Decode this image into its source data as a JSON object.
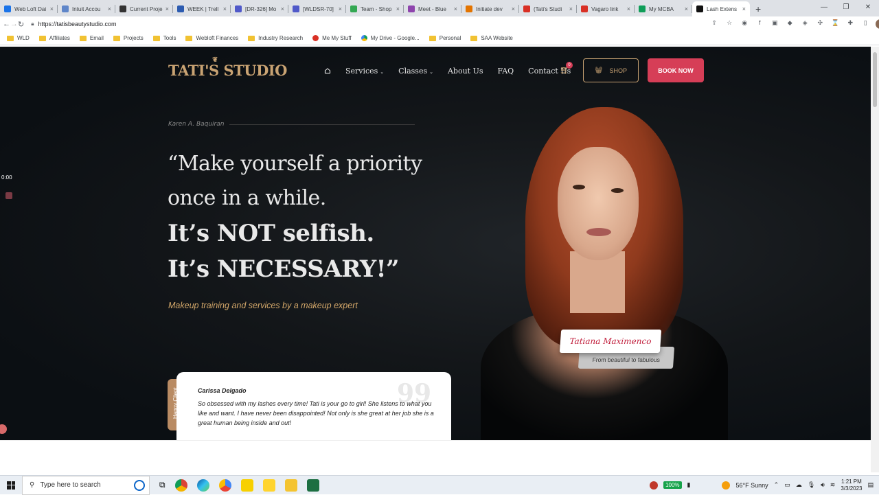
{
  "browser": {
    "tabs": [
      {
        "title": "Web Loft Dai",
        "color": "#1a73e8"
      },
      {
        "title": "Intuit Accou",
        "color": "#5f86c9"
      },
      {
        "title": "Current Proje",
        "color": "#333333"
      },
      {
        "title": "WEEK | Trell",
        "color": "#2c5bb0"
      },
      {
        "title": "[DR-326] Mo",
        "color": "#5059c9"
      },
      {
        "title": "[WLDSR-70]",
        "color": "#5059c9"
      },
      {
        "title": "Team - Shop",
        "color": "#34a853"
      },
      {
        "title": "Meet - Blue",
        "color": "#8e44ad"
      },
      {
        "title": "Initiate dev",
        "color": "#e37400"
      },
      {
        "title": "(Tati's Studi",
        "color": "#d93025"
      },
      {
        "title": "Vagaro link",
        "color": "#d93025"
      },
      {
        "title": "My MCBA",
        "color": "#0f9d58"
      },
      {
        "title": "Lash Extens",
        "color": "#111111"
      }
    ],
    "url": "https://tatisbeautystudio.com",
    "bookmarks": [
      {
        "label": "WLD",
        "kind": "folder"
      },
      {
        "label": "Affiliates",
        "kind": "folder"
      },
      {
        "label": "Email",
        "kind": "folder"
      },
      {
        "label": "Projects",
        "kind": "folder"
      },
      {
        "label": "Tools",
        "kind": "folder"
      },
      {
        "label": "Webloft Finances",
        "kind": "folder"
      },
      {
        "label": "Industry Research",
        "kind": "folder"
      },
      {
        "label": "Me My Stuff",
        "kind": "dot"
      },
      {
        "label": "My Drive - Google...",
        "kind": "drive"
      },
      {
        "label": "Personal",
        "kind": "folder"
      },
      {
        "label": "SAA Website",
        "kind": "folder"
      }
    ]
  },
  "site": {
    "logo": "TATI'S STUDIO",
    "nav": {
      "services": "Services",
      "classes": "Classes",
      "about": "About Us",
      "faq": "FAQ",
      "contact": "Contact Us"
    },
    "cart_count": "0",
    "shop_label": "SHOP",
    "book_label": "BOOK NOW",
    "author": "Karen A. Baquiran",
    "quote_line1": "“Make yourself a priority",
    "quote_line2": "once in a while.",
    "quote_line3": "It’s NOT selfish.",
    "quote_line4": "It’s NECESSARY!”",
    "tagline": "Makeup training and services by a makeup expert",
    "signature": "Tatiana Maximenco",
    "signature_sub": "From beautiful to fabulous",
    "testimonial": {
      "tab": "Happy Client",
      "name": "Carissa Delgado",
      "text": "So obsessed with my lashes every time! Tati is your go to girl! She listens to what you like and want. I have never been disappointed! Not only is she great at her job she is a great human being inside and out!",
      "mark": "99"
    },
    "recording_time": "0:00",
    "colors": {
      "accent_gold": "#c9a373",
      "accent_pink": "#d63e57",
      "background": "#0b1016"
    }
  },
  "taskbar": {
    "search_placeholder": "Type here to search",
    "battery": "100%",
    "weather": "56°F  Sunny",
    "time": "1:21 PM",
    "date": "3/3/2023"
  }
}
